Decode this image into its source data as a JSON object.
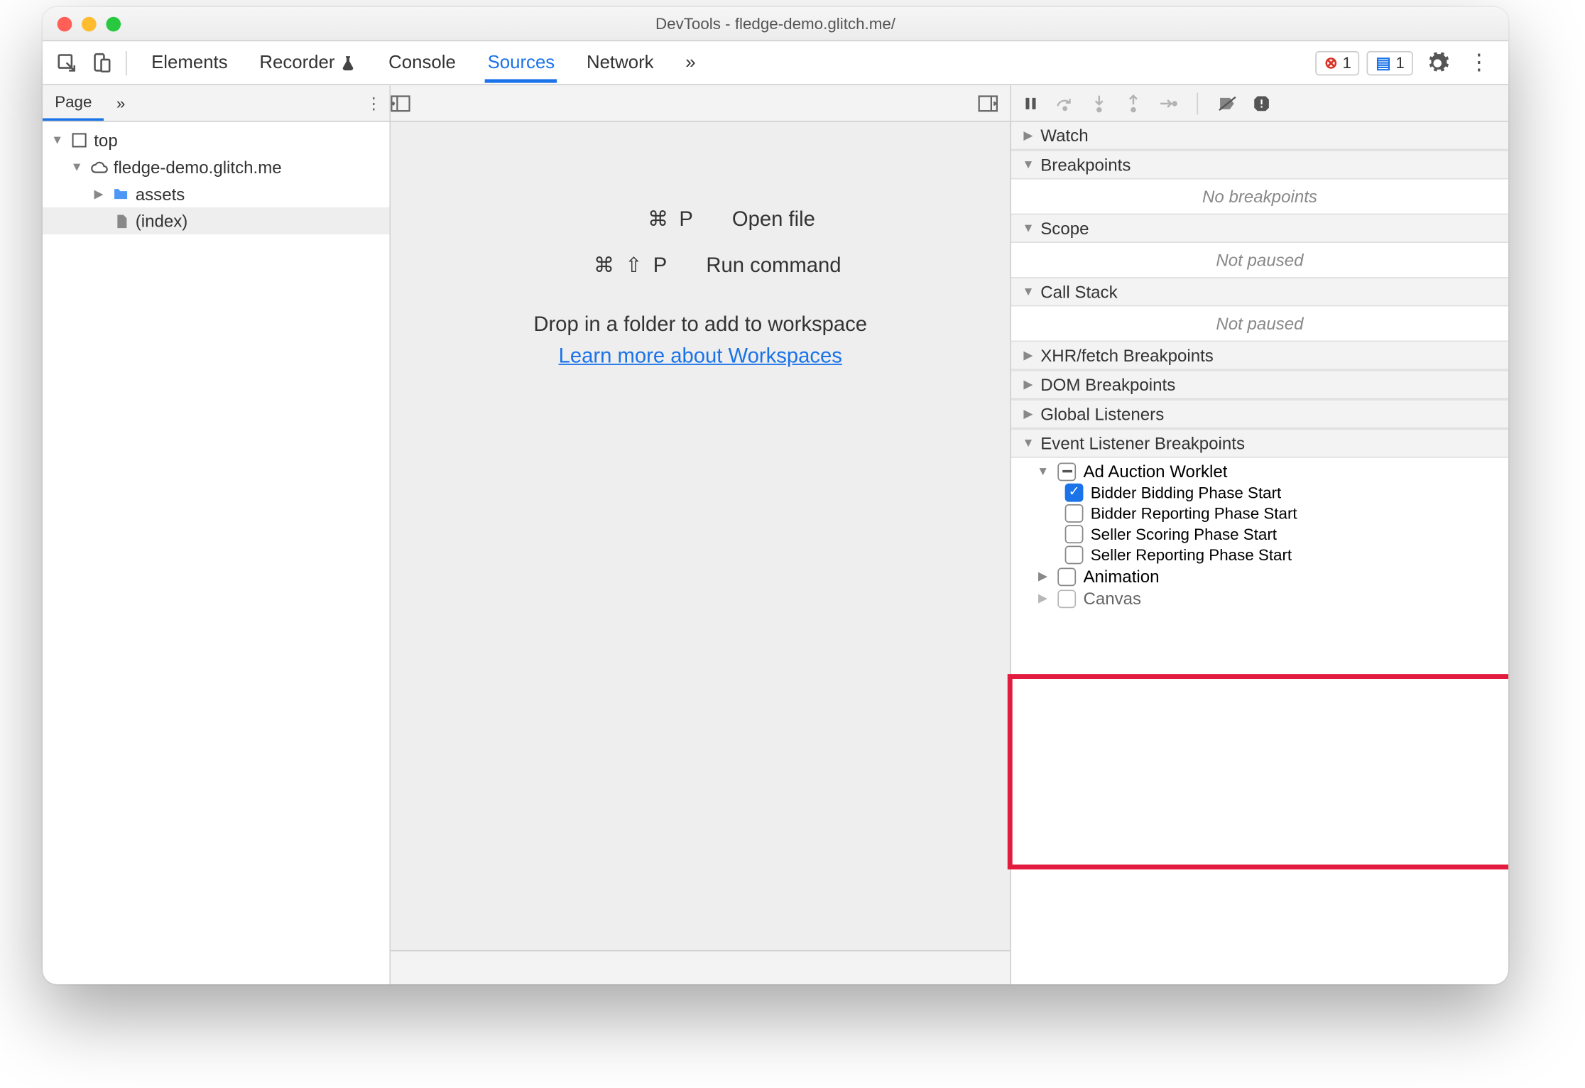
{
  "window": {
    "title": "DevTools - fledge-demo.glitch.me/"
  },
  "tabs": {
    "items": [
      "Elements",
      "Recorder",
      "Console",
      "Sources",
      "Network"
    ],
    "active": "Sources",
    "more": "»"
  },
  "badges": {
    "errors": "1",
    "messages": "1"
  },
  "left": {
    "subtab": "Page",
    "more": "»",
    "tree": {
      "top": "top",
      "origin": "fledge-demo.glitch.me",
      "folder": "assets",
      "file": "(index)"
    }
  },
  "mid": {
    "kbd_open": "⌘ P",
    "open_file": "Open file",
    "kbd_run": "⌘ ⇧ P",
    "run_command": "Run command",
    "drop_hint": "Drop in a folder to add to workspace",
    "learn_more": "Learn more about Workspaces"
  },
  "right": {
    "watch": "Watch",
    "breakpoints": "Breakpoints",
    "no_breakpoints": "No breakpoints",
    "scope": "Scope",
    "not_paused1": "Not paused",
    "callstack": "Call Stack",
    "not_paused2": "Not paused",
    "xhr": "XHR/fetch Breakpoints",
    "dom": "DOM Breakpoints",
    "global": "Global Listeners",
    "evt": "Event Listener Breakpoints",
    "ad_auction": "Ad Auction Worklet",
    "events": {
      "e1": {
        "label": "Bidder Bidding Phase Start",
        "checked": true
      },
      "e2": {
        "label": "Bidder Reporting Phase Start",
        "checked": false
      },
      "e3": {
        "label": "Seller Scoring Phase Start",
        "checked": false
      },
      "e4": {
        "label": "Seller Reporting Phase Start",
        "checked": false
      }
    },
    "animation": "Animation",
    "canvas": "Canvas"
  }
}
